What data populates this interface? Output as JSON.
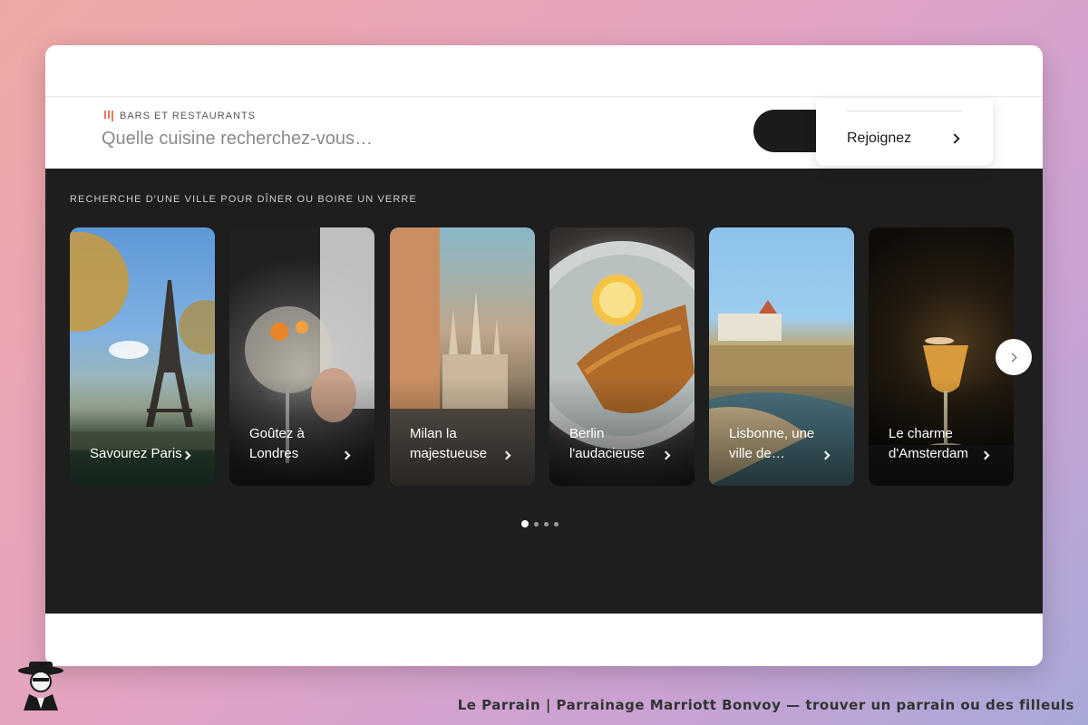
{
  "search": {
    "category_label": "BARS ET RESTAURANTS",
    "placeholder": "Quelle cuisine recherchez-vous…"
  },
  "dropdown": {
    "item_label": "Rejoignez"
  },
  "section": {
    "heading": "RECHERCHE D'UNE VILLE POUR DÎNER OU BOIRE UN VERRE",
    "cards": [
      {
        "title": "Savourez Paris",
        "image": "eiffel-tower-photo"
      },
      {
        "title": "Goûtez à Londres",
        "image": "gin-tonic-glass-photo"
      },
      {
        "title": "Milan la majestueuse",
        "image": "milan-cathedral-photo"
      },
      {
        "title": "Berlin l'audacieuse",
        "image": "schnitzel-plate-photo"
      },
      {
        "title": "Lisbonne, une ville de…",
        "image": "lisbon-coast-photo"
      },
      {
        "title": "Le charme d'Amsterdam",
        "image": "cocktail-glass-photo"
      }
    ],
    "pagination": {
      "total": 4,
      "active": 1
    }
  },
  "footer": {
    "caption": "Le Parrain | Parrainage Marriott Bonvoy — trouver un parrain ou des filleuls"
  },
  "colors": {
    "accent": "#e07a5f",
    "dark_section": "#1e1e1e",
    "button": "#1b1b1b"
  }
}
